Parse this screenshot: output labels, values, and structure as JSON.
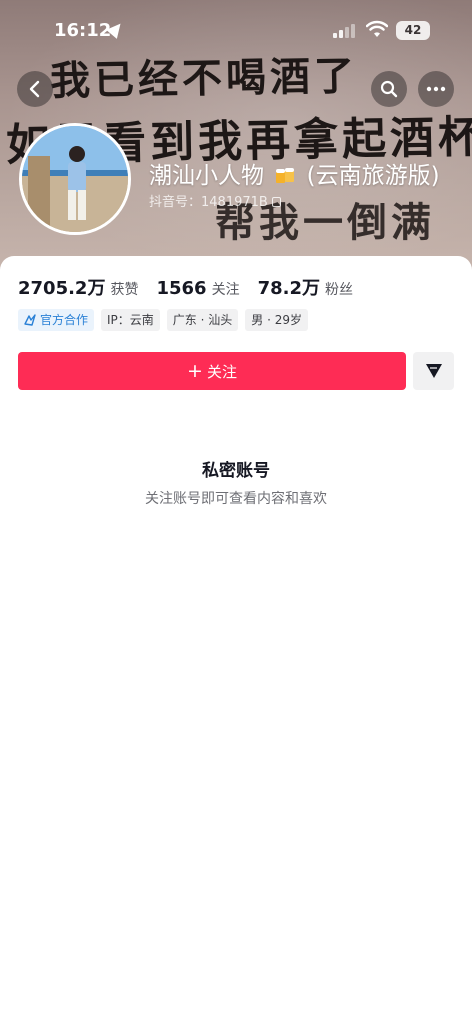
{
  "status_bar": {
    "time": "16:12",
    "battery": "42"
  },
  "banner": {
    "line1": "我已经不喝酒了",
    "line2": "如果看到我再拿起酒杯",
    "line3": "帮我一倒满"
  },
  "profile": {
    "name_prefix": "潮汕小人物",
    "name_suffix": "(云南旅游版)",
    "id_text": "抖音号：1481971B"
  },
  "stats": [
    {
      "num": "2705.2万",
      "label": "获赞"
    },
    {
      "num": "1566",
      "label": "关注"
    },
    {
      "num": "78.2万",
      "label": "粉丝"
    }
  ],
  "tags": {
    "official": "官方合作",
    "ip": "IP：云南",
    "location": "广东 · 汕头",
    "gender_age": "男 · 29岁"
  },
  "actions": {
    "follow_label": "关注"
  },
  "private": {
    "title": "私密账号",
    "description": "关注账号即可查看内容和喜欢"
  },
  "colors": {
    "accent": "#fe2c55",
    "official": "#2a81d6"
  },
  "icons": [
    "back-icon",
    "search-icon",
    "more-icon",
    "share-icon",
    "official-icon",
    "copy-icon",
    "beer-icon"
  ]
}
